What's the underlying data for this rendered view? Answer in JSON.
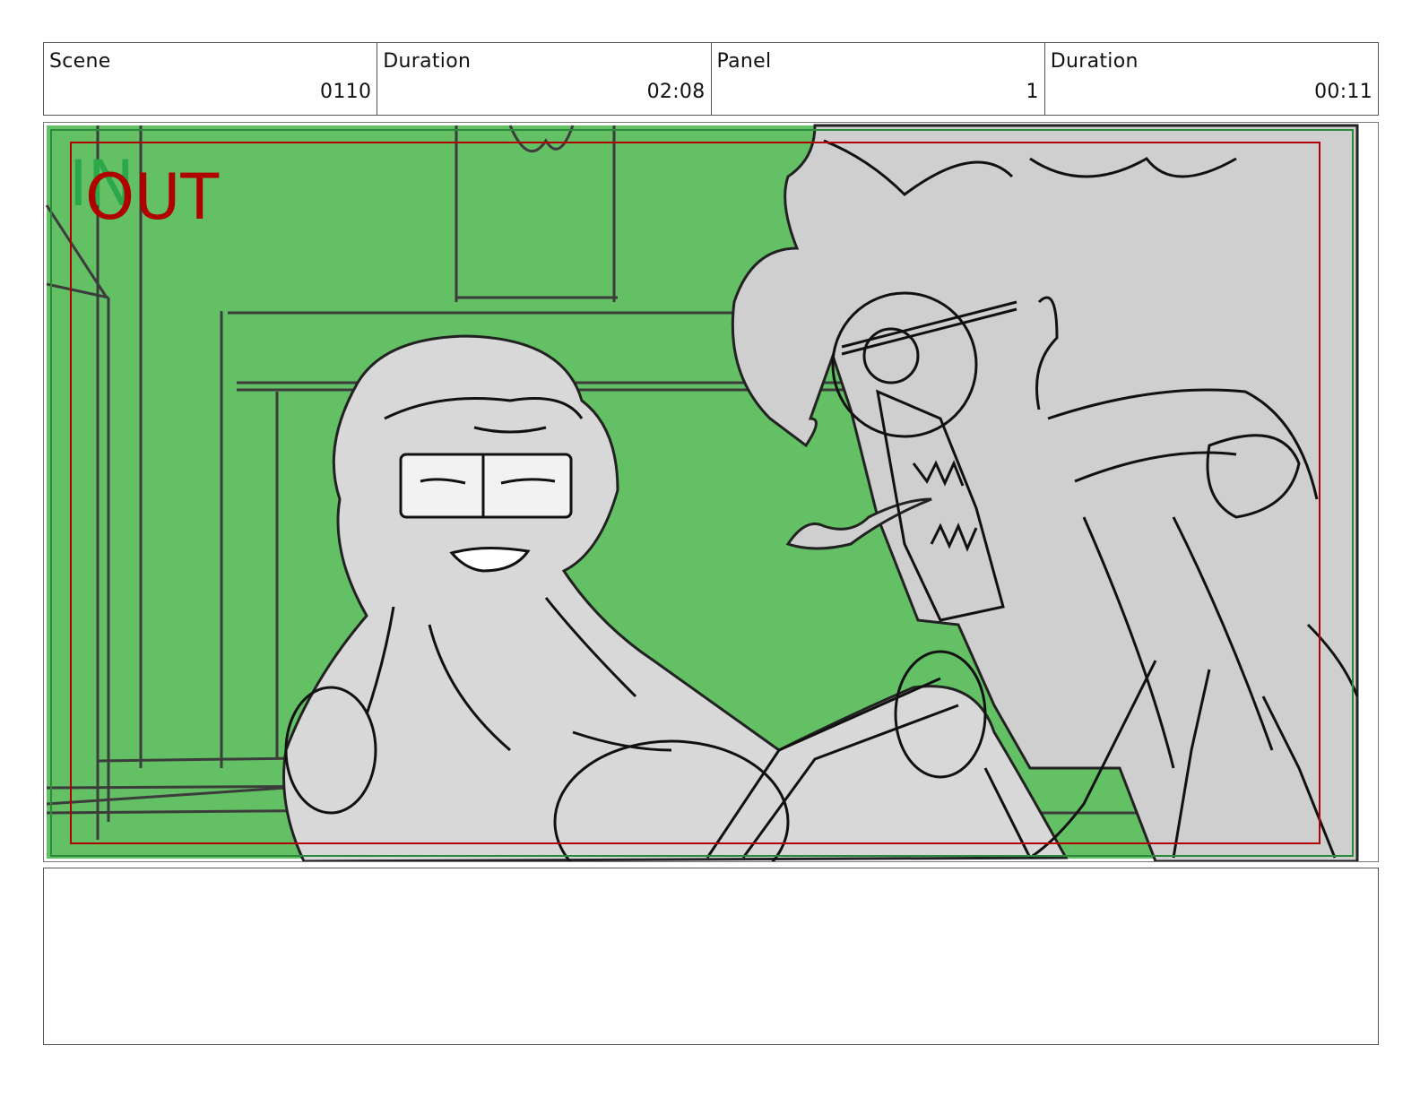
{
  "header": {
    "scene": {
      "label": "Scene",
      "value": "0110"
    },
    "scene_duration": {
      "label": "Duration",
      "value": "02:08"
    },
    "panel": {
      "label": "Panel",
      "value": "1"
    },
    "panel_duration": {
      "label": "Duration",
      "value": "00:11"
    }
  },
  "frame": {
    "in_marker": "IN",
    "out_marker": "OUT",
    "background_color": "#64c064",
    "safe_area_color": "#b00000",
    "sketch_fill_color": "#cfcfcf"
  },
  "notes": {
    "text": ""
  }
}
